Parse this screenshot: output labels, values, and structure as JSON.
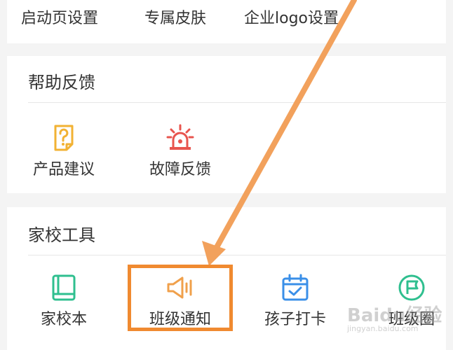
{
  "top_row": {
    "items": [
      "启动页设置",
      "专属皮肤",
      "企业logo设置"
    ]
  },
  "help_feedback": {
    "title": "帮助反馈",
    "items": [
      {
        "label": "产品建议",
        "icon": "question-note-icon",
        "color": "#f2b233"
      },
      {
        "label": "故障反馈",
        "icon": "alarm-siren-icon",
        "color": "#e8544e"
      }
    ]
  },
  "home_school_tools": {
    "title": "家校工具",
    "items": [
      {
        "label": "家校本",
        "icon": "notebook-icon",
        "color": "#2fbf8f"
      },
      {
        "label": "班级通知",
        "icon": "megaphone-icon",
        "color": "#f0a04b"
      },
      {
        "label": "孩子打卡",
        "icon": "calendar-check-icon",
        "color": "#3a8fe8"
      },
      {
        "label": "班级圈",
        "icon": "circle-flag-icon",
        "color": "#2fbf8f"
      }
    ]
  },
  "annotation": {
    "highlight_color": "#f08a30",
    "arrow_color": "#f2a15c"
  },
  "watermark": {
    "text": "Baidu经验",
    "sub": "jingyan.baidu.com"
  }
}
